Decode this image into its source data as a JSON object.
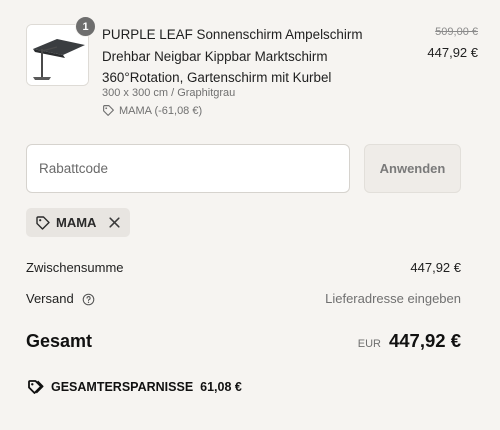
{
  "product": {
    "quantity": "1",
    "title": "PURPLE LEAF Sonnenschirm Ampelschirm Drehbar Neigbar Kippbar Marktschirm 360°Rotation, Gartenschirm mit Kurbel",
    "variant": "300 x 300 cm / Graphitgrau",
    "discount": "MAMA (-61,08 €)",
    "original_price": "509,00 €",
    "price": "447,92 €",
    "image_icon": "patio-umbrella-image"
  },
  "discount_form": {
    "placeholder": "Rabattcode",
    "value": "",
    "apply_label": "Anwenden"
  },
  "applied_code": {
    "label": "MAMA",
    "tag_icon": "tag-icon",
    "remove_icon": "close-icon"
  },
  "summary": {
    "subtotal_label": "Zwischensumme",
    "subtotal_value": "447,92 €",
    "shipping_label": "Versand",
    "shipping_value": "Lieferadresse eingeben",
    "total_label": "Gesamt",
    "currency": "EUR",
    "total_value": "447,92 €",
    "savings_label": "GESAMTERSPARNISSE",
    "savings_value": "61,08 €"
  },
  "colors": {
    "background": "#f6f4f1",
    "text": "#1a1a1a",
    "muted": "#707070",
    "badge": "#6e6e6e"
  }
}
